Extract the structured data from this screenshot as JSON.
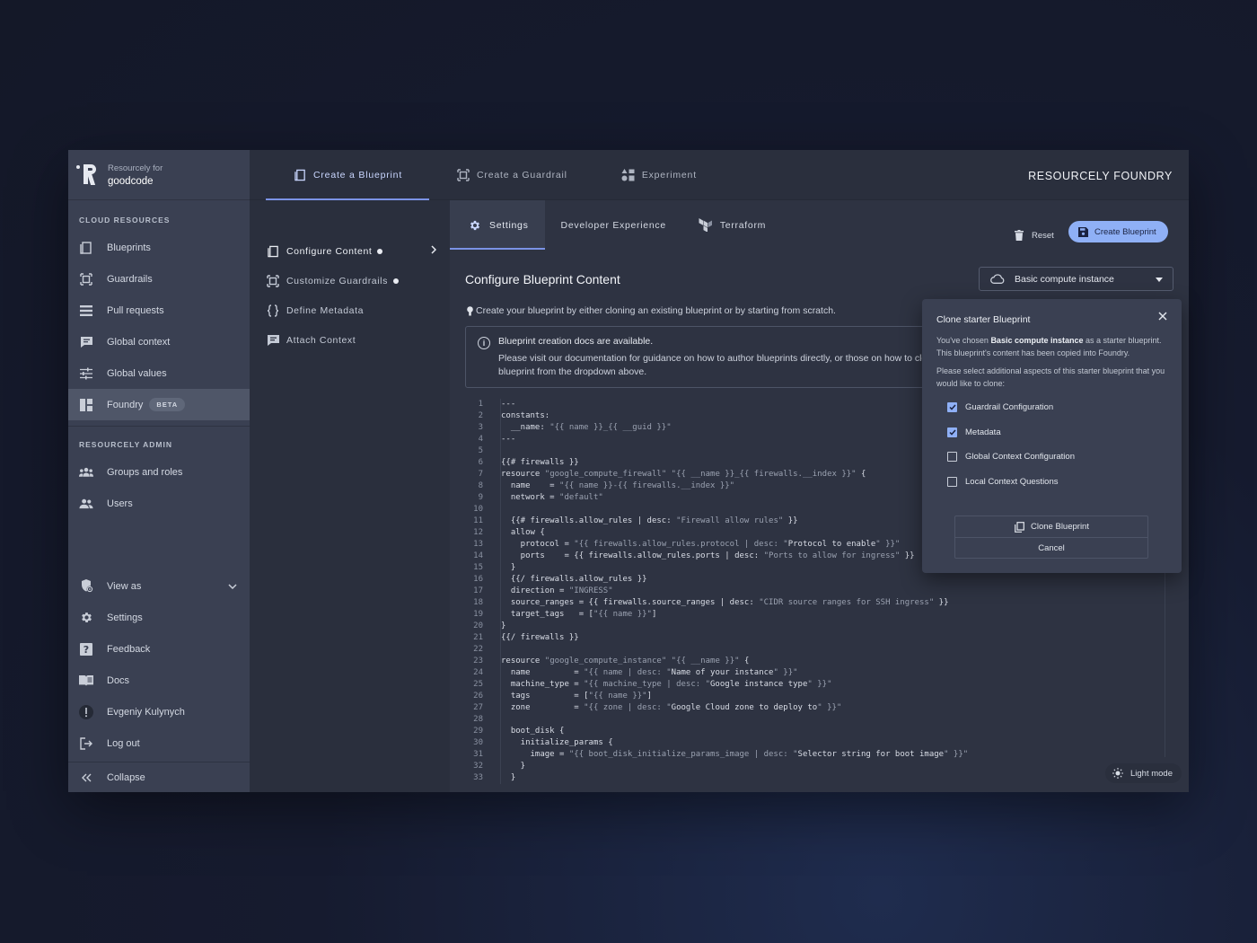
{
  "brand": {
    "subtitle": "Resourcely for",
    "org": "goodcode"
  },
  "sidebar": {
    "cloud_section": "CLOUD RESOURCES",
    "cloud_items": [
      {
        "label": "Blueprints",
        "icon": "blueprint-icon"
      },
      {
        "label": "Guardrails",
        "icon": "guardrail-icon"
      },
      {
        "label": "Pull requests",
        "icon": "list-icon"
      },
      {
        "label": "Global context",
        "icon": "chat-icon"
      },
      {
        "label": "Global values",
        "icon": "sliders-icon"
      },
      {
        "label": "Foundry",
        "icon": "dashboard-icon",
        "badge": "BETA",
        "active": true
      }
    ],
    "admin_section": "RESOURCELY ADMIN",
    "admin_items": [
      {
        "label": "Groups and roles",
        "icon": "group-icon"
      },
      {
        "label": "Users",
        "icon": "users-icon"
      }
    ],
    "bottom_items": [
      {
        "label": "View as",
        "icon": "view-as-icon"
      },
      {
        "label": "Settings",
        "icon": "gear-icon"
      },
      {
        "label": "Feedback",
        "icon": "help-icon"
      },
      {
        "label": "Docs",
        "icon": "book-icon"
      },
      {
        "label": "Evgeniy Kulynych",
        "icon": "avatar-icon"
      },
      {
        "label": "Log out",
        "icon": "logout-icon"
      }
    ],
    "collapse": "Collapse"
  },
  "top_tabs": [
    {
      "label": "Create a Blueprint",
      "icon": "blueprint-icon",
      "active": true
    },
    {
      "label": "Create a Guardrail",
      "icon": "guardrail-icon"
    },
    {
      "label": "Experiment",
      "icon": "experiment-icon"
    }
  ],
  "app_title": "RESOURCELY FOUNDRY",
  "steps": [
    {
      "label": "Configure Content",
      "icon": "blueprint-icon"
    },
    {
      "label": "Customize Guardrails",
      "icon": "guardrail-icon"
    },
    {
      "label": "Define Metadata",
      "icon": "braces-icon"
    },
    {
      "label": "Attach Context",
      "icon": "chat-icon"
    }
  ],
  "sub_tabs": [
    {
      "label": "Settings",
      "icon": "gear-icon"
    },
    {
      "label": "Developer Experience"
    },
    {
      "label": "Terraform",
      "icon": "terraform-icon"
    }
  ],
  "toolbar": {
    "reset": "Reset",
    "create": "Create Blueprint"
  },
  "content": {
    "title": "Configure Blueprint Content",
    "select_value": "Basic compute instance",
    "hint": "Create your blueprint by either cloning an existing blueprint or by starting from scratch.",
    "info_head": "Blueprint creation docs are available.",
    "info_line1": "Please visit our documentation for guidance on how to author blueprints directly, or those on how to clone a",
    "info_line2": "blueprint from the dropdown above."
  },
  "code_lines": [
    "---",
    "constants:",
    "  __name: \"{{ name }}_{{ __guid }}\"",
    "---",
    "",
    "{{# firewalls }}",
    "resource \"google_compute_firewall\" \"{{ __name }}_{{ firewalls.__index }}\" {",
    "  name    = \"{{ name }}-{{ firewalls.__index }}\"",
    "  network = \"default\"",
    "",
    "  {{# firewalls.allow_rules | desc: \"Firewall allow rules\" }}",
    "  allow {",
    "    protocol = \"{{ firewalls.allow_rules.protocol | desc: \"Protocol to enable\" }}\"",
    "    ports    = {{ firewalls.allow_rules.ports | desc: \"Ports to allow for ingress\" }}",
    "  }",
    "  {{/ firewalls.allow_rules }}",
    "  direction = \"INGRESS\"",
    "  source_ranges = {{ firewalls.source_ranges | desc: \"CIDR source ranges for SSH ingress\" }}",
    "  target_tags   = [\"{{ name }}\"]",
    "}",
    "{{/ firewalls }}",
    "",
    "resource \"google_compute_instance\" \"{{ __name }}\" {",
    "  name         = \"{{ name | desc: \"Name of your instance\" }}\"",
    "  machine_type = \"{{ machine_type | desc: \"Google instance type\" }}\"",
    "  tags         = [\"{{ name }}\"]",
    "  zone         = \"{{ zone | desc: \"Google Cloud zone to deploy to\" }}\"",
    "",
    "  boot_disk {",
    "    initialize_params {",
    "      image = \"{{ boot_disk_initialize_params_image | desc: \"Selector string for boot image\" }}\"",
    "    }",
    "  }"
  ],
  "popup": {
    "title": "Clone starter Blueprint",
    "text_pre": "You've chosen ",
    "text_bold": "Basic compute instance",
    "text_post": " as a starter blueprint. This blueprint's content has been copied into Foundry.",
    "text2": "Please select additional aspects of this starter blueprint that you would like to clone:",
    "options": [
      {
        "label": "Guardrail Configuration",
        "checked": true
      },
      {
        "label": "Metadata",
        "checked": true
      },
      {
        "label": "Global Context Configuration",
        "checked": false
      },
      {
        "label": "Local Context Questions",
        "checked": false
      }
    ],
    "clone_button": "Clone Blueprint",
    "cancel_button": "Cancel"
  },
  "light_mode": "Light mode",
  "colors": {
    "accent": "#8fb0f6",
    "active_tab_underline": "#7b93e6",
    "sidebar_bg": "#3a4052",
    "panel_bg": "#2e3342"
  }
}
